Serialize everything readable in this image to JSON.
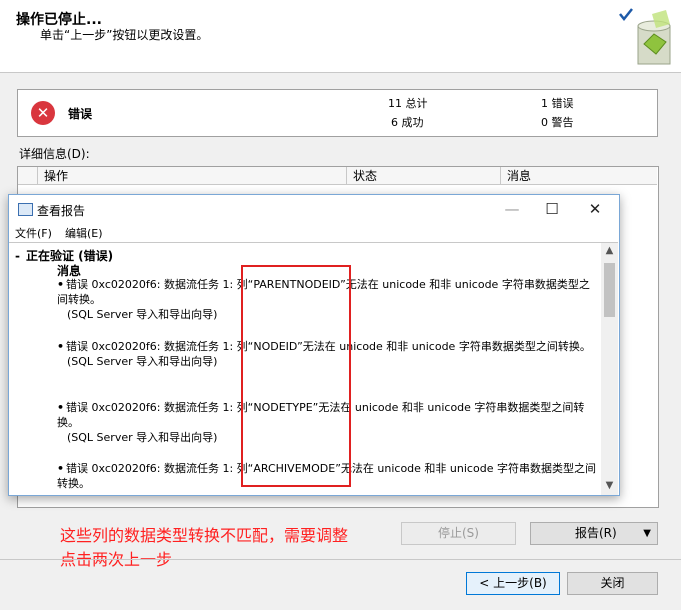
{
  "wizard": {
    "title": "操作已停止...",
    "subtitle": "单击“上一步”按钮以更改设置。"
  },
  "summary": {
    "status": "错误",
    "total": "11 总计",
    "success": "6 成功",
    "errors": "1 错误",
    "warnings": "0 警告"
  },
  "details_label": "详细信息(D):",
  "table": {
    "columns": [
      "操作",
      "状态",
      "消息"
    ]
  },
  "report": {
    "title": "查看报告",
    "menu": [
      "文件(F)",
      "编辑(E)"
    ],
    "section_heading": "正在验证 (错误)",
    "messages_heading": "消息",
    "entries": [
      {
        "text": "错误 0xc02020f6: 数据流任务 1: 列“PARENTNODEID”无法在 unicode 和非 unicode 字符串数据类型之间转换。",
        "source": "(SQL Server 导入和导出向导)"
      },
      {
        "text": "错误 0xc02020f6: 数据流任务 1: 列“NODEID”无法在 unicode 和非 unicode 字符串数据类型之间转换。",
        "source": "(SQL Server 导入和导出向导)"
      },
      {
        "text": "错误 0xc02020f6: 数据流任务 1: 列“NODETYPE”无法在 unicode 和非 unicode 字符串数据类型之间转换。",
        "source": "(SQL Server 导入和导出向导)"
      },
      {
        "text": "错误 0xc02020f6: 数据流任务 1: 列“ARCHIVEMODE”无法在 unicode 和非 unicode 字符串数据类型之间转换。",
        "source": ""
      }
    ]
  },
  "annotation": {
    "line1": "这些列的数据类型转换不匹配，需要调整",
    "line2": "点击两次上一步"
  },
  "buttons": {
    "stop": "停止(S)",
    "report": "报告(R)",
    "back": "< 上一步(B)",
    "close": "关闭"
  },
  "colors": {
    "error_red": "#d9363e",
    "annotation_red": "#ff2020",
    "window_border": "#7aa7d6"
  }
}
